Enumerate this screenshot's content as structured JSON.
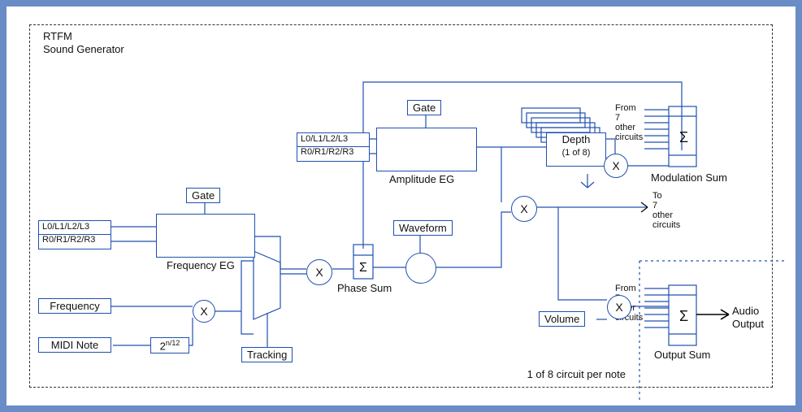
{
  "title1": "RTFM",
  "title2": "Sound Generator",
  "footer": "1 of 8 circuit per note",
  "labels": {
    "gate": "Gate",
    "freq_eg": "Frequency EG",
    "amp_eg": "Amplitude EG",
    "phase_sum": "Phase Sum",
    "mod_sum": "Modulation Sum",
    "out_sum": "Output Sum",
    "audio_out1": "Audio",
    "audio_out2": "Output",
    "from7a": "From",
    "from7b": "7",
    "from7c": "other",
    "from7d": "circuits",
    "to7a": "To",
    "to7b": "7",
    "to7c": "other",
    "to7d": "circuits",
    "tracking": "Tracking",
    "waveform": "Waveform",
    "volume": "Volume",
    "depth": "Depth",
    "depth_sub": "(1 of 8)",
    "frequency": "Frequency",
    "midi_note": "MIDI Note",
    "two_pow": "2",
    "two_exp": "n/12",
    "eg_L": "L0/L1/L2/L3",
    "eg_R": "R0/R1/R2/R3"
  },
  "glyphs": {
    "x": "X",
    "sigma": "Σ"
  }
}
